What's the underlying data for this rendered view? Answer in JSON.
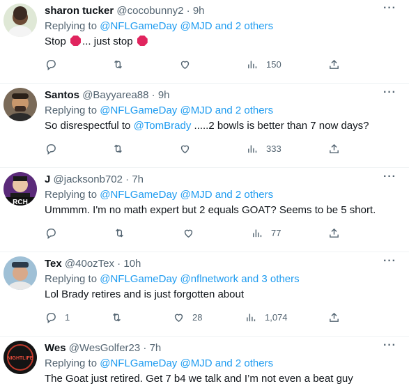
{
  "tweets": [
    {
      "name": "sharon tucker",
      "handle": "@cocobunny2",
      "time": "9h",
      "replying_prefix": "Replying to ",
      "replying_links": "@NFLGameDay @MJD and 2 others",
      "text_a": "Stop ",
      "text_b": "... just stop ",
      "replies": "",
      "retweets": "",
      "likes": "",
      "views": "150",
      "avatar_color": "#d9e3d0"
    },
    {
      "name": "Santos",
      "handle": "@Bayyarea88",
      "time": "9h",
      "replying_prefix": "Replying to ",
      "replying_links": "@NFLGameDay @MJD and 2 others",
      "text_a": "So disrespectful to ",
      "text_mention": "@TomBrady",
      "text_b": " .....2 bowls is better than 7 now days?",
      "replies": "",
      "retweets": "",
      "likes": "",
      "views": "333",
      "avatar_color": "#5a4a3a"
    },
    {
      "name": "J",
      "handle": "@jacksonb702",
      "time": "7h",
      "replying_prefix": "Replying to ",
      "replying_links": "@NFLGameDay @MJD and 2 others",
      "text_a": "Ummmm. I'm no math expert but 2 equals GOAT? Seems to be 5 short.",
      "replies": "",
      "retweets": "",
      "likes": "",
      "views": "77",
      "avatar_color": "#6b2b8a",
      "avatar_text": "RCH"
    },
    {
      "name": "Tex",
      "handle": "@40ozTex",
      "time": "10h",
      "replying_prefix": "Replying to ",
      "replying_links": "@NFLGameDay @nflnetwork and 3 others",
      "text_a": "Lol Brady retires and is just forgotten about",
      "replies": "1",
      "retweets": "",
      "likes": "28",
      "views": "1,074",
      "avatar_color": "#8fb0c8"
    },
    {
      "name": "Wes",
      "handle": "@WesGolfer23",
      "time": "7h",
      "replying_prefix": "Replying to ",
      "replying_links": "@NFLGameDay @MJD and 2 others",
      "text_a": "The Goat just retired.  Get 7 b4 we talk and I’m not even a beat guy",
      "replies": "",
      "retweets": "",
      "likes": "",
      "views": "",
      "avatar_color": "#1a1a1a",
      "avatar_text": "NIGHTLIFE"
    }
  ],
  "ui": {
    "more_label": "···",
    "dot": " · "
  }
}
